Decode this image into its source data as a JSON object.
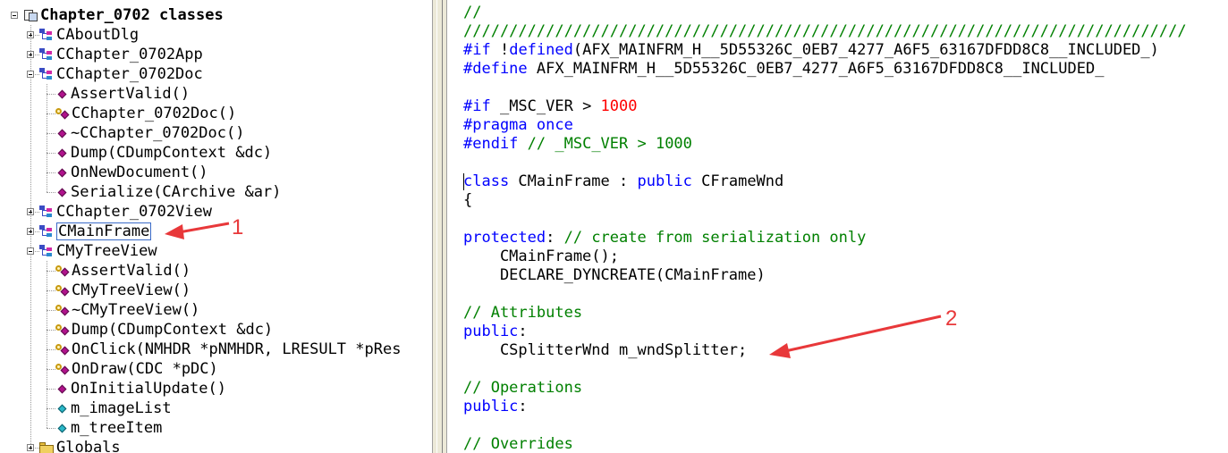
{
  "tree": {
    "items": [
      {
        "label": "Chapter_0702 classes",
        "icon": "project-icon",
        "level": 0,
        "expander": "minus",
        "root": true
      },
      {
        "label": "CAboutDlg",
        "icon": "class-icon",
        "level": 1,
        "expander": "plus"
      },
      {
        "label": "CChapter_0702App",
        "icon": "class-icon",
        "level": 1,
        "expander": "plus"
      },
      {
        "label": "CChapter_0702Doc",
        "icon": "class-icon",
        "level": 1,
        "expander": "minus"
      },
      {
        "label": "AssertValid()",
        "icon": "method-icon",
        "level": 2
      },
      {
        "label": "CChapter_0702Doc()",
        "icon": "protected-method-icon",
        "level": 2
      },
      {
        "label": "~CChapter_0702Doc()",
        "icon": "method-icon",
        "level": 2
      },
      {
        "label": "Dump(CDumpContext &dc)",
        "icon": "method-icon",
        "level": 2
      },
      {
        "label": "OnNewDocument()",
        "icon": "method-icon",
        "level": 2
      },
      {
        "label": "Serialize(CArchive &ar)",
        "icon": "method-icon",
        "level": 2
      },
      {
        "label": "CChapter_0702View",
        "icon": "class-icon",
        "level": 1,
        "expander": "plus"
      },
      {
        "label": "CMainFrame",
        "icon": "class-icon",
        "level": 1,
        "expander": "plus",
        "selected": true
      },
      {
        "label": "CMyTreeView",
        "icon": "class-icon",
        "level": 1,
        "expander": "minus"
      },
      {
        "label": "AssertValid()",
        "icon": "protected-method-icon",
        "level": 2
      },
      {
        "label": "CMyTreeView()",
        "icon": "protected-method-icon",
        "level": 2
      },
      {
        "label": "~CMyTreeView()",
        "icon": "protected-method-icon",
        "level": 2
      },
      {
        "label": "Dump(CDumpContext &dc)",
        "icon": "protected-method-icon",
        "level": 2
      },
      {
        "label": "OnClick(NMHDR *pNMHDR, LRESULT *pRes",
        "icon": "protected-method-icon",
        "level": 2
      },
      {
        "label": "OnDraw(CDC *pDC)",
        "icon": "protected-method-icon",
        "level": 2
      },
      {
        "label": "OnInitialUpdate()",
        "icon": "method-icon",
        "level": 2
      },
      {
        "label": "m_imageList",
        "icon": "member-icon",
        "level": 2
      },
      {
        "label": "m_treeItem",
        "icon": "member-icon",
        "level": 2
      },
      {
        "label": "Globals",
        "icon": "folder-icon",
        "level": 1,
        "expander": "plus"
      }
    ]
  },
  "code": {
    "colors": {
      "comment": "#008000",
      "keyword": "#0000ff",
      "number": "#ff0000",
      "text": "#000000"
    },
    "lines": [
      [
        {
          "t": "//",
          "c": "comment"
        }
      ],
      [
        {
          "t": "///////////////////////////////////////////////////////////////////////////////",
          "c": "comment"
        }
      ],
      [
        {
          "t": "#if",
          "c": "keyword"
        },
        {
          "t": " !",
          "c": "plain"
        },
        {
          "t": "defined",
          "c": "keyword"
        },
        {
          "t": "(AFX_MAINFRM_H__5D55326C_0EB7_4277_A6F5_63167DFDD8C8__INCLUDED_)",
          "c": "plain"
        }
      ],
      [
        {
          "t": "#define",
          "c": "keyword"
        },
        {
          "t": " AFX_MAINFRM_H__5D55326C_0EB7_4277_A6F5_63167DFDD8C8__INCLUDED_",
          "c": "plain"
        }
      ],
      [],
      [
        {
          "t": "#if",
          "c": "keyword"
        },
        {
          "t": " _MSC_VER > ",
          "c": "plain"
        },
        {
          "t": "1000",
          "c": "number"
        }
      ],
      [
        {
          "t": "#pragma",
          "c": "keyword"
        },
        {
          "t": " ",
          "c": "plain"
        },
        {
          "t": "once",
          "c": "keyword"
        }
      ],
      [
        {
          "t": "#endif",
          "c": "keyword"
        },
        {
          "t": " ",
          "c": "plain"
        },
        {
          "t": "// _MSC_VER > 1000",
          "c": "comment"
        }
      ],
      [],
      [
        {
          "t": "class",
          "c": "keyword"
        },
        {
          "t": " CMainFrame : ",
          "c": "plain"
        },
        {
          "t": "public",
          "c": "keyword"
        },
        {
          "t": " CFrameWnd",
          "c": "plain"
        }
      ],
      [
        {
          "t": "{",
          "c": "plain"
        }
      ],
      [],
      [
        {
          "t": "protected",
          "c": "keyword"
        },
        {
          "t": ": ",
          "c": "plain"
        },
        {
          "t": "// create from serialization only",
          "c": "comment"
        }
      ],
      [
        {
          "t": "    CMainFrame();",
          "c": "plain"
        }
      ],
      [
        {
          "t": "    DECLARE_DYNCREATE(CMainFrame)",
          "c": "plain"
        }
      ],
      [],
      [
        {
          "t": "// Attributes",
          "c": "comment"
        }
      ],
      [
        {
          "t": "public",
          "c": "keyword"
        },
        {
          "t": ":",
          "c": "plain"
        }
      ],
      [
        {
          "t": "    CSplitterWnd m_wndSplitter;",
          "c": "plain"
        }
      ],
      [],
      [
        {
          "t": "// Operations",
          "c": "comment"
        }
      ],
      [
        {
          "t": "public",
          "c": "keyword"
        },
        {
          "t": ":",
          "c": "plain"
        }
      ],
      [],
      [
        {
          "t": "// Overrides",
          "c": "comment"
        }
      ]
    ]
  },
  "annotations": {
    "color": "#e8383a",
    "labels": [
      {
        "id": "1",
        "text": "1"
      },
      {
        "id": "2",
        "text": "2"
      }
    ]
  }
}
